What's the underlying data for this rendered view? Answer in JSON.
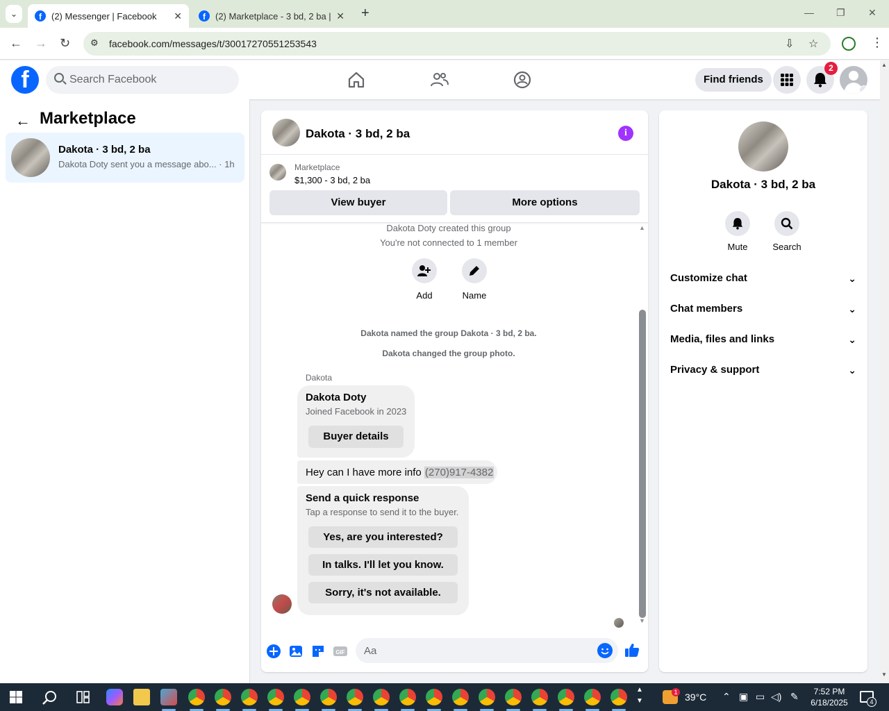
{
  "browser": {
    "tabs": [
      {
        "title": "(2) Messenger | Facebook",
        "active": true
      },
      {
        "title": "(2) Marketplace - 3 bd, 2 ba | Fa",
        "active": false
      }
    ],
    "url": "facebook.com/messages/t/30017270551253543"
  },
  "fb_header": {
    "search_placeholder": "Search Facebook",
    "find_friends_label": "Find friends",
    "notification_count": "2"
  },
  "left_panel": {
    "title": "Marketplace",
    "conversations": [
      {
        "name": "Dakota · 3 bd, 2 ba",
        "snippet": "Dakota Doty sent you a message abo...",
        "time": "· 1h"
      }
    ]
  },
  "chat": {
    "title": "Dakota · 3 bd, 2 ba",
    "listing": {
      "source": "Marketplace",
      "price_line": "$1,300 - 3 bd, 2 ba",
      "view_buyer_label": "View buyer",
      "more_options_label": "More options"
    },
    "system": {
      "created": "Dakota Doty created this group",
      "not_connected": "You're not connected to 1 member",
      "add_label": "Add",
      "name_label": "Name",
      "named_group": "Dakota named the group Dakota · 3 bd, 2 ba.",
      "changed_photo": "Dakota changed the group photo."
    },
    "sender_name": "Dakota",
    "buyer_card": {
      "name": "Dakota Doty",
      "joined": "Joined Facebook in 2023",
      "button": "Buyer details"
    },
    "message": {
      "text": "Hey can I have more info ",
      "phone": "(270)917-4382"
    },
    "quick_response": {
      "title": "Send a quick response",
      "subtitle": "Tap a response to send it to the buyer.",
      "options": [
        "Yes, are you interested?",
        "In talks. I'll let you know.",
        "Sorry, it's not available."
      ]
    },
    "composer_placeholder": "Aa"
  },
  "right_panel": {
    "title": "Dakota · 3 bd, 2 ba",
    "mute_label": "Mute",
    "search_label": "Search",
    "sections": [
      "Customize chat",
      "Chat members",
      "Media, files and links",
      "Privacy & support"
    ]
  },
  "taskbar": {
    "temperature": "39°C",
    "weather_badge": "1",
    "time": "7:52 PM",
    "date": "6/18/2025",
    "notif_count": "4"
  },
  "colors": {
    "fb_blue": "#0866ff",
    "accent_purple": "#a033ff",
    "selected_conv": "#ebf5ff",
    "badge_red": "#e41e3f"
  }
}
